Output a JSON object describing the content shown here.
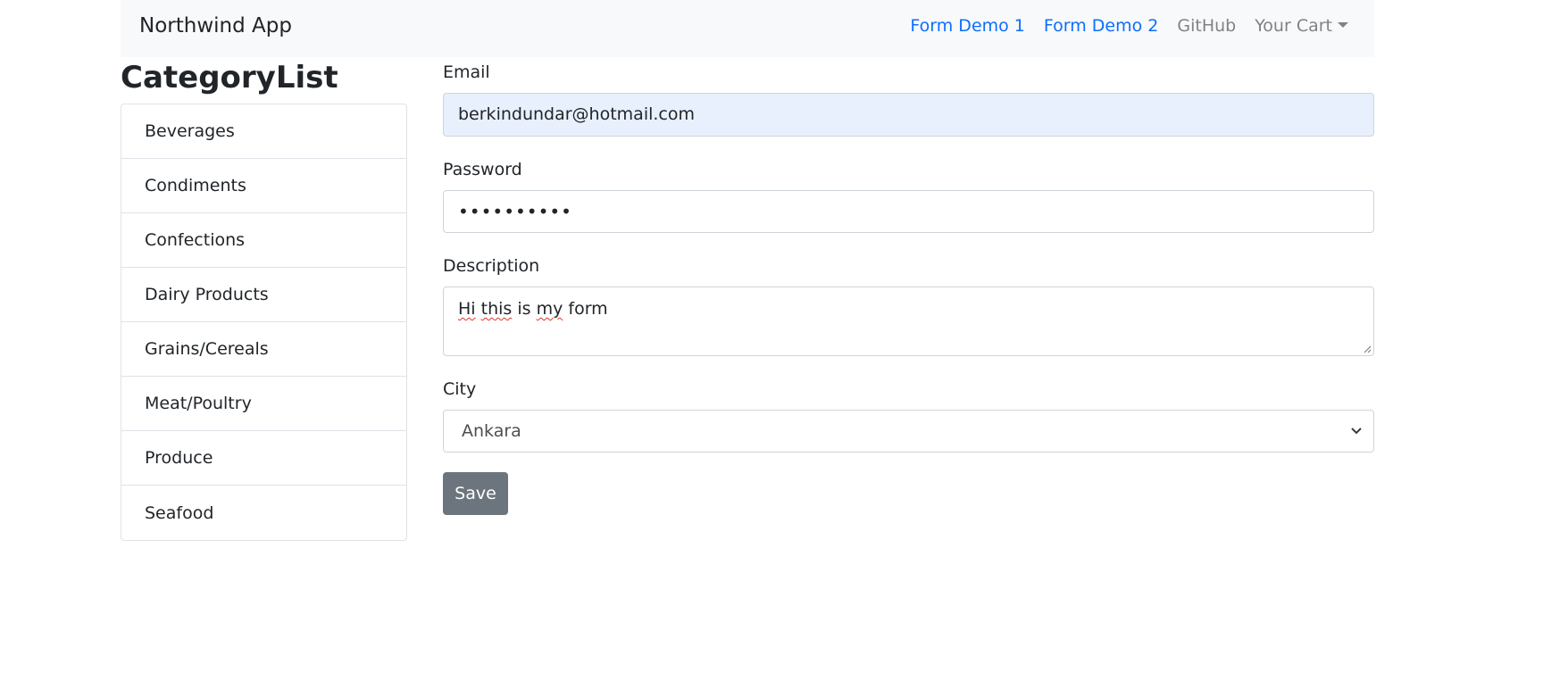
{
  "navbar": {
    "brand": "Northwind App",
    "links": {
      "form_demo_1": "Form Demo 1",
      "form_demo_2": "Form Demo 2",
      "github": "GitHub",
      "cart": "Your Cart"
    }
  },
  "sidebar": {
    "title": "CategoryList",
    "items": [
      {
        "label": "Beverages"
      },
      {
        "label": "Condiments"
      },
      {
        "label": "Confections"
      },
      {
        "label": "Dairy Products"
      },
      {
        "label": "Grains/Cereals"
      },
      {
        "label": "Meat/Poultry"
      },
      {
        "label": "Produce"
      },
      {
        "label": "Seafood"
      }
    ]
  },
  "form": {
    "email": {
      "label": "Email",
      "value": "berkindundar@hotmail.com"
    },
    "password": {
      "label": "Password",
      "value": "••••••••••"
    },
    "description": {
      "label": "Description",
      "words": [
        "Hi",
        "this",
        "is",
        "my",
        "form"
      ]
    },
    "city": {
      "label": "City",
      "selected": "Ankara"
    },
    "save_label": "Save"
  },
  "colors": {
    "link_blue": "#0d6efd",
    "link_gray": "#7f8387",
    "button_gray": "#6c757d",
    "autofill_bg": "#e8f0fe"
  }
}
